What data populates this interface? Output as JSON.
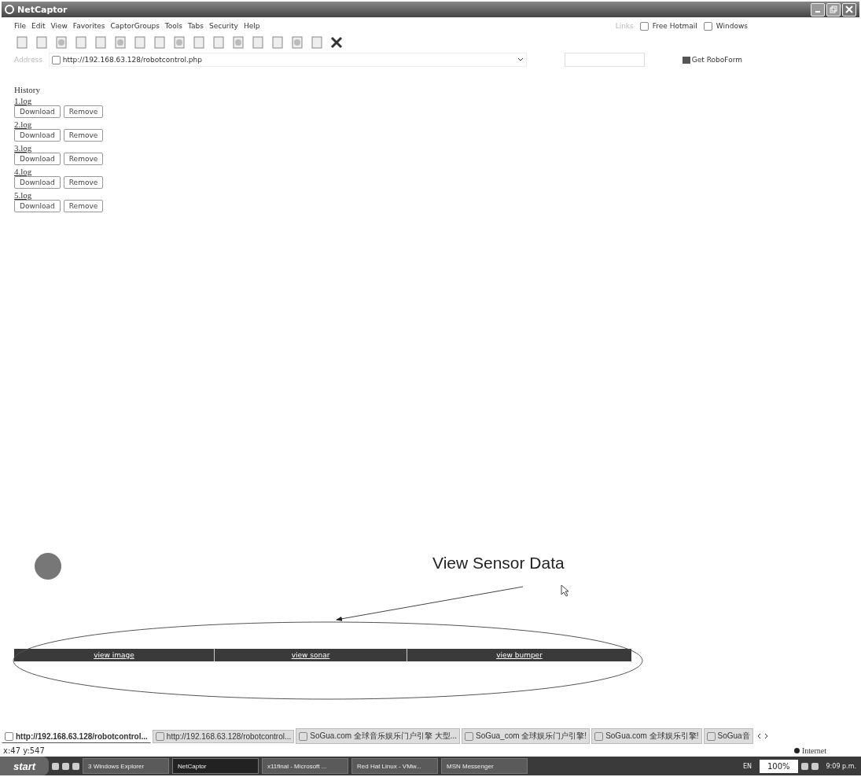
{
  "window": {
    "title": "NetCaptor"
  },
  "menu": [
    "File",
    "Edit",
    "View",
    "Favorites",
    "CaptorGroups",
    "Tools",
    "Tabs",
    "Security",
    "Help"
  ],
  "links": {
    "label": "Links",
    "items": [
      "Free Hotmail",
      "Windows"
    ]
  },
  "address": {
    "label": "Address",
    "value": "http://192.168.63.128/robotcontrol.php"
  },
  "roboform": "Get RoboForm",
  "page": {
    "heading": "History",
    "logs": [
      {
        "name": "1.log",
        "buttons": [
          "Download",
          "Remove"
        ]
      },
      {
        "name": "2.log",
        "buttons": [
          "Download",
          "Remove"
        ]
      },
      {
        "name": "3.log",
        "buttons": [
          "Download",
          "Remove"
        ]
      },
      {
        "name": "4.log",
        "buttons": [
          "Download",
          "Remove"
        ]
      },
      {
        "name": "5.log",
        "buttons": [
          "Download",
          "Remove"
        ]
      }
    ],
    "nav": [
      "view image",
      "view sonar",
      "view bumper"
    ],
    "annotation": "View Sensor Data"
  },
  "tabs": [
    {
      "label": "http://192.168.63.128/robotcontrol...",
      "selected": true
    },
    {
      "label": "http://192.168.63.128/robotcontrol...",
      "selected": false
    },
    {
      "label": "SoGua.com 全球音乐娱乐门户引擎 大型...",
      "selected": false
    },
    {
      "label": "SoGua_com 全球娱乐门户引擎!",
      "selected": false
    },
    {
      "label": "SoGua.com 全球娱乐引擎!",
      "selected": false
    },
    {
      "label": "SoGua音",
      "selected": false
    }
  ],
  "status_bar": {
    "coords": "x:47 y:547",
    "zone": "Internet"
  },
  "taskbar": {
    "start": "start",
    "tasks": [
      {
        "label": "3 Windows Explorer",
        "selected": false
      },
      {
        "label": "NetCaptor",
        "selected": true
      },
      {
        "label": "x11final - Microsoft ...",
        "selected": false
      },
      {
        "label": "Red Hat Linux - VMw...",
        "selected": false
      },
      {
        "label": "MSN Messenger",
        "selected": false
      }
    ],
    "lang": "EN",
    "zoom": "100%",
    "clock": "9:09 p.m."
  }
}
